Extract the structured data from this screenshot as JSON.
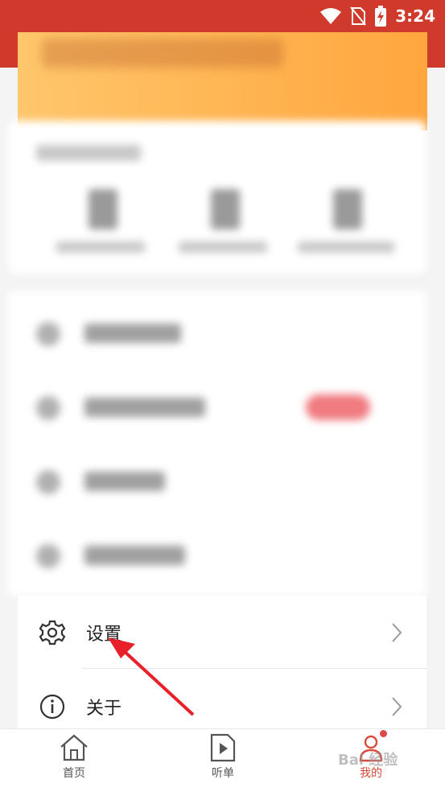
{
  "status_bar": {
    "time": "3:24"
  },
  "menu": [
    {
      "label": "设置",
      "icon": "gear-icon"
    },
    {
      "label": "关于",
      "icon": "info-icon"
    }
  ],
  "tabs": [
    {
      "label": "首页",
      "icon": "home-icon",
      "active": false
    },
    {
      "label": "听单",
      "icon": "play-list-icon",
      "active": false
    },
    {
      "label": "我的",
      "icon": "user-icon",
      "active": true
    }
  ],
  "colors": {
    "brand": "#cf3a2c",
    "accent": "#d84b3c",
    "inactive": "#555555"
  },
  "watermark": "Bai 经验"
}
